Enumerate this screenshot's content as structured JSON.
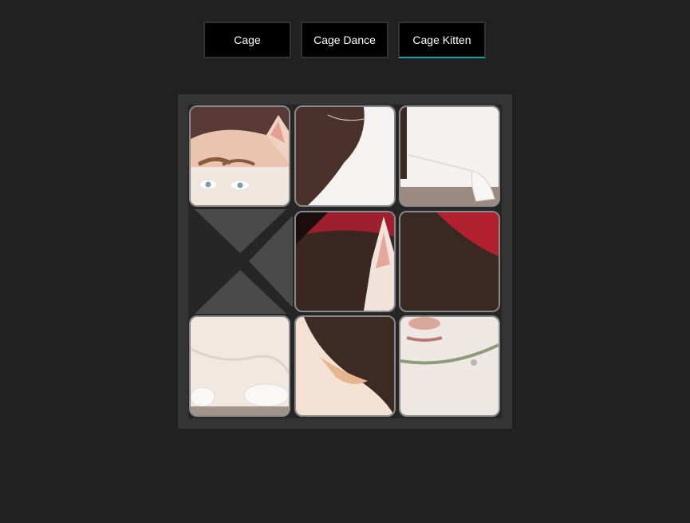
{
  "tabs": [
    {
      "label": "Cage",
      "active": false
    },
    {
      "label": "Cage Dance",
      "active": false
    },
    {
      "label": "Cage Kitten",
      "active": true
    }
  ],
  "puzzle": {
    "grid_size": 3,
    "tiles": [
      {
        "row": 0,
        "col": 0,
        "piece": "face-eyes-ear"
      },
      {
        "row": 0,
        "col": 1,
        "piece": "white-fur-top"
      },
      {
        "row": 0,
        "col": 2,
        "piece": "white-fur-paw-top"
      },
      {
        "row": 1,
        "col": 0,
        "piece": "empty"
      },
      {
        "row": 1,
        "col": 1,
        "piece": "ear-red-background"
      },
      {
        "row": 1,
        "col": 2,
        "piece": "red-background"
      },
      {
        "row": 2,
        "col": 0,
        "piece": "paws-bottom"
      },
      {
        "row": 2,
        "col": 1,
        "piece": "fur-side"
      },
      {
        "row": 2,
        "col": 2,
        "piece": "mouth-collar"
      }
    ]
  },
  "colors": {
    "accent": "#0fa3a3",
    "page_bg": "#212121",
    "board_bg": "#343434"
  }
}
